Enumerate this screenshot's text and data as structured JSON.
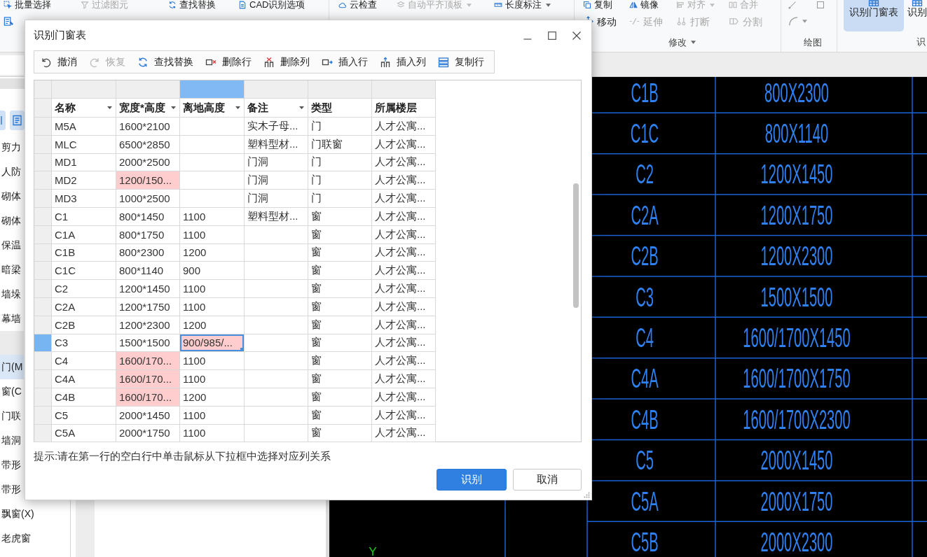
{
  "ribbon": {
    "groups": [
      {
        "kind": "tools",
        "top_items": [
          {
            "label": "批量选择",
            "disabled": false,
            "dropdown": false
          },
          {
            "label": "过滤图元",
            "disabled": true,
            "dropdown": false
          },
          {
            "label": "查找替换",
            "disabled": false,
            "dropdown": false
          },
          {
            "label": "CAD识别选项",
            "disabled": false,
            "dropdown": false
          }
        ]
      },
      {
        "kind": "tools",
        "top_items": [
          {
            "label": "云检查",
            "disabled": false,
            "dropdown": false
          },
          {
            "label": "自动平齐顶板",
            "disabled": true,
            "dropdown": true
          },
          {
            "label": "长度标注",
            "disabled": false,
            "dropdown": true
          }
        ]
      },
      {
        "kind": "tools",
        "label": "修改",
        "label_dropdown": true,
        "top_items": [
          {
            "label": "复制",
            "disabled": false,
            "dropdown": false
          },
          {
            "label": "镜像",
            "disabled": false,
            "dropdown": false
          },
          {
            "label": "对齐",
            "disabled": true,
            "dropdown": true
          },
          {
            "label": "合并",
            "disabled": true,
            "dropdown": false
          }
        ],
        "bottom_items": [
          {
            "label": "移动",
            "disabled": false
          },
          {
            "label": "延伸",
            "disabled": true
          },
          {
            "label": "打断",
            "disabled": true
          },
          {
            "label": "分割",
            "disabled": true
          }
        ]
      },
      {
        "kind": "drawing",
        "label": "绘图"
      },
      {
        "kind": "large",
        "label": "识",
        "large_buttons": [
          {
            "label": "识别门窗表",
            "selected": true
          },
          {
            "label": "识别",
            "selected": false
          }
        ]
      }
    ]
  },
  "sidebar": {
    "groups": [
      {
        "items": [
          {
            "label": "剪力",
            "selected": false
          },
          {
            "label": "人防",
            "selected": false
          },
          {
            "label": "砌体",
            "selected": false
          },
          {
            "label": "砌体",
            "selected": false
          },
          {
            "label": "保温",
            "selected": false
          },
          {
            "label": "暗梁",
            "selected": false
          },
          {
            "label": "墙垛",
            "selected": false
          },
          {
            "label": "幕墙",
            "selected": false
          }
        ]
      },
      {
        "items": [
          {
            "label": "门(M",
            "selected": true
          },
          {
            "label": "窗(C",
            "selected": false
          },
          {
            "label": "门联",
            "selected": false
          },
          {
            "label": "墙洞",
            "selected": false
          },
          {
            "label": "带形",
            "selected": false
          },
          {
            "label": "带形",
            "selected": false
          },
          {
            "label": "飘窗(X)",
            "selected": false
          },
          {
            "label": "老虎窗",
            "selected": false
          }
        ]
      }
    ]
  },
  "cad_drawing": {
    "rows": [
      {
        "name": "C1B",
        "size": "800X2300"
      },
      {
        "name": "C1C",
        "size": "800X1140"
      },
      {
        "name": "C2",
        "size": "1200X1450"
      },
      {
        "name": "C2A",
        "size": "1200X1750"
      },
      {
        "name": "C2B",
        "size": "1200X2300"
      },
      {
        "name": "C3",
        "size": "1500X1500"
      },
      {
        "name": "C4",
        "size": "1600/1700X1450"
      },
      {
        "name": "C4A",
        "size": "1600/1700X1750"
      },
      {
        "name": "C4B",
        "size": "1600/1700X2300"
      },
      {
        "name": "C5",
        "size": "2000X1450"
      },
      {
        "name": "C5A",
        "size": "2000X1750"
      },
      {
        "name": "C5B",
        "size": "2000X2300"
      }
    ],
    "axis_label": "Y"
  },
  "dialog": {
    "title": "识别门窗表",
    "toolbar": [
      {
        "label": "撤消",
        "disabled": false
      },
      {
        "label": "恢复",
        "disabled": true
      },
      {
        "label": "查找替换",
        "disabled": false
      },
      {
        "label": "删除行",
        "disabled": false
      },
      {
        "label": "删除列",
        "disabled": false
      },
      {
        "label": "插入行",
        "disabled": false
      },
      {
        "label": "插入列",
        "disabled": false
      },
      {
        "label": "复制行",
        "disabled": false
      }
    ],
    "table": {
      "columns": [
        {
          "label": "名称",
          "dropdown": true,
          "selected": false
        },
        {
          "label": "宽度*高度",
          "dropdown": true,
          "selected": false
        },
        {
          "label": "离地高度",
          "dropdown": true,
          "selected": true
        },
        {
          "label": "备注",
          "dropdown": true,
          "selected": false
        },
        {
          "label": "类型",
          "dropdown": false,
          "selected": false
        },
        {
          "label": "所属楼层",
          "dropdown": false,
          "selected": false
        }
      ],
      "rows": [
        {
          "selected": false,
          "cells": [
            {
              "text": "M5A",
              "flagged": false,
              "selected": false
            },
            {
              "text": "1600*2100",
              "flagged": false,
              "selected": false
            },
            {
              "flagged": false,
              "selected": false
            },
            {
              "text": "实木子母...",
              "flagged": false,
              "selected": false
            },
            {
              "text": "门",
              "flagged": false,
              "selected": false
            },
            {
              "text": "人才公寓...",
              "flagged": false,
              "selected": false
            }
          ]
        },
        {
          "selected": false,
          "cells": [
            {
              "text": "MLC",
              "flagged": false,
              "selected": false
            },
            {
              "text": "6500*2850",
              "flagged": false,
              "selected": false
            },
            {
              "flagged": false,
              "selected": false
            },
            {
              "text": "塑料型材...",
              "flagged": false,
              "selected": false
            },
            {
              "text": "门联窗",
              "flagged": false,
              "selected": false
            },
            {
              "text": "人才公寓...",
              "flagged": false,
              "selected": false
            }
          ]
        },
        {
          "selected": false,
          "cells": [
            {
              "text": "MD1",
              "flagged": false,
              "selected": false
            },
            {
              "text": "2000*2500",
              "flagged": false,
              "selected": false
            },
            {
              "flagged": false,
              "selected": false
            },
            {
              "text": "门洞",
              "flagged": false,
              "selected": false
            },
            {
              "text": "门",
              "flagged": false,
              "selected": false
            },
            {
              "text": "人才公寓...",
              "flagged": false,
              "selected": false
            }
          ]
        },
        {
          "selected": false,
          "cells": [
            {
              "text": "MD2",
              "flagged": false,
              "selected": false
            },
            {
              "text": "1200/150...",
              "flagged": true,
              "selected": false
            },
            {
              "flagged": false,
              "selected": false
            },
            {
              "text": "门洞",
              "flagged": false,
              "selected": false
            },
            {
              "text": "门",
              "flagged": false,
              "selected": false
            },
            {
              "text": "人才公寓...",
              "flagged": false,
              "selected": false
            }
          ]
        },
        {
          "selected": false,
          "cells": [
            {
              "text": "MD3",
              "flagged": false,
              "selected": false
            },
            {
              "text": "1000*2500",
              "flagged": false,
              "selected": false
            },
            {
              "flagged": false,
              "selected": false
            },
            {
              "text": "门洞",
              "flagged": false,
              "selected": false
            },
            {
              "text": "门",
              "flagged": false,
              "selected": false
            },
            {
              "text": "人才公寓...",
              "flagged": false,
              "selected": false
            }
          ]
        },
        {
          "selected": false,
          "cells": [
            {
              "text": "C1",
              "flagged": false,
              "selected": false
            },
            {
              "text": "800*1450",
              "flagged": false,
              "selected": false
            },
            {
              "text": "1100",
              "flagged": false,
              "selected": false
            },
            {
              "text": "塑料型材...",
              "flagged": false,
              "selected": false
            },
            {
              "text": "窗",
              "flagged": false,
              "selected": false
            },
            {
              "text": "人才公寓...",
              "flagged": false,
              "selected": false
            }
          ]
        },
        {
          "selected": false,
          "cells": [
            {
              "text": "C1A",
              "flagged": false,
              "selected": false
            },
            {
              "text": "800*1750",
              "flagged": false,
              "selected": false
            },
            {
              "text": "1100",
              "flagged": false,
              "selected": false
            },
            {
              "flagged": false,
              "selected": false
            },
            {
              "text": "窗",
              "flagged": false,
              "selected": false
            },
            {
              "text": "人才公寓...",
              "flagged": false,
              "selected": false
            }
          ]
        },
        {
          "selected": false,
          "cells": [
            {
              "text": "C1B",
              "flagged": false,
              "selected": false
            },
            {
              "text": "800*2300",
              "flagged": false,
              "selected": false
            },
            {
              "text": "1200",
              "flagged": false,
              "selected": false
            },
            {
              "flagged": false,
              "selected": false
            },
            {
              "text": "窗",
              "flagged": false,
              "selected": false
            },
            {
              "text": "人才公寓...",
              "flagged": false,
              "selected": false
            }
          ]
        },
        {
          "selected": false,
          "cells": [
            {
              "text": "C1C",
              "flagged": false,
              "selected": false
            },
            {
              "text": "800*1140",
              "flagged": false,
              "selected": false
            },
            {
              "text": "900",
              "flagged": false,
              "selected": false
            },
            {
              "flagged": false,
              "selected": false
            },
            {
              "text": "窗",
              "flagged": false,
              "selected": false
            },
            {
              "text": "人才公寓...",
              "flagged": false,
              "selected": false
            }
          ]
        },
        {
          "selected": false,
          "cells": [
            {
              "text": "C2",
              "flagged": false,
              "selected": false
            },
            {
              "text": "1200*1450",
              "flagged": false,
              "selected": false
            },
            {
              "text": "1100",
              "flagged": false,
              "selected": false
            },
            {
              "flagged": false,
              "selected": false
            },
            {
              "text": "窗",
              "flagged": false,
              "selected": false
            },
            {
              "text": "人才公寓...",
              "flagged": false,
              "selected": false
            }
          ]
        },
        {
          "selected": false,
          "cells": [
            {
              "text": "C2A",
              "flagged": false,
              "selected": false
            },
            {
              "text": "1200*1750",
              "flagged": false,
              "selected": false
            },
            {
              "text": "1100",
              "flagged": false,
              "selected": false
            },
            {
              "flagged": false,
              "selected": false
            },
            {
              "text": "窗",
              "flagged": false,
              "selected": false
            },
            {
              "text": "人才公寓...",
              "flagged": false,
              "selected": false
            }
          ]
        },
        {
          "selected": false,
          "cells": [
            {
              "text": "C2B",
              "flagged": false,
              "selected": false
            },
            {
              "text": "1200*2300",
              "flagged": false,
              "selected": false
            },
            {
              "text": "1200",
              "flagged": false,
              "selected": false
            },
            {
              "flagged": false,
              "selected": false
            },
            {
              "text": "窗",
              "flagged": false,
              "selected": false
            },
            {
              "text": "人才公寓...",
              "flagged": false,
              "selected": false
            }
          ]
        },
        {
          "selected": true,
          "cells": [
            {
              "text": "C3",
              "flagged": false,
              "selected": false
            },
            {
              "text": "1500*1500",
              "flagged": false,
              "selected": false
            },
            {
              "text": "900/985/...",
              "flagged": true,
              "selected": true
            },
            {
              "flagged": false,
              "selected": false
            },
            {
              "text": "窗",
              "flagged": false,
              "selected": false
            },
            {
              "text": "人才公寓...",
              "flagged": false,
              "selected": false
            }
          ]
        },
        {
          "selected": false,
          "cells": [
            {
              "text": "C4",
              "flagged": false,
              "selected": false
            },
            {
              "text": "1600/170...",
              "flagged": true,
              "selected": false
            },
            {
              "text": "1100",
              "flagged": false,
              "selected": false
            },
            {
              "flagged": false,
              "selected": false
            },
            {
              "text": "窗",
              "flagged": false,
              "selected": false
            },
            {
              "text": "人才公寓...",
              "flagged": false,
              "selected": false
            }
          ]
        },
        {
          "selected": false,
          "cells": [
            {
              "text": "C4A",
              "flagged": false,
              "selected": false
            },
            {
              "text": "1600/170...",
              "flagged": true,
              "selected": false
            },
            {
              "text": "1100",
              "flagged": false,
              "selected": false
            },
            {
              "flagged": false,
              "selected": false
            },
            {
              "text": "窗",
              "flagged": false,
              "selected": false
            },
            {
              "text": "人才公寓...",
              "flagged": false,
              "selected": false
            }
          ]
        },
        {
          "selected": false,
          "cells": [
            {
              "text": "C4B",
              "flagged": false,
              "selected": false
            },
            {
              "text": "1600/170...",
              "flagged": true,
              "selected": false
            },
            {
              "text": "1200",
              "flagged": false,
              "selected": false
            },
            {
              "flagged": false,
              "selected": false
            },
            {
              "text": "窗",
              "flagged": false,
              "selected": false
            },
            {
              "text": "人才公寓...",
              "flagged": false,
              "selected": false
            }
          ]
        },
        {
          "selected": false,
          "cells": [
            {
              "text": "C5",
              "flagged": false,
              "selected": false
            },
            {
              "text": "2000*1450",
              "flagged": false,
              "selected": false
            },
            {
              "text": "1100",
              "flagged": false,
              "selected": false
            },
            {
              "flagged": false,
              "selected": false
            },
            {
              "text": "窗",
              "flagged": false,
              "selected": false
            },
            {
              "text": "人才公寓...",
              "flagged": false,
              "selected": false
            }
          ]
        },
        {
          "selected": false,
          "cells": [
            {
              "text": "C5A",
              "flagged": false,
              "selected": false
            },
            {
              "text": "2000*1750",
              "flagged": false,
              "selected": false
            },
            {
              "text": "1100",
              "flagged": false,
              "selected": false
            },
            {
              "flagged": false,
              "selected": false
            },
            {
              "text": "窗",
              "flagged": false,
              "selected": false
            },
            {
              "text": "人才公寓...",
              "flagged": false,
              "selected": false
            }
          ]
        }
      ]
    },
    "hint": "提示:请在第一行的空白行中单击鼠标从下拉框中选择对应列关系",
    "buttons": [
      {
        "label": "识别",
        "kind": "primary"
      },
      {
        "label": "取消",
        "kind": "secondary"
      }
    ]
  }
}
